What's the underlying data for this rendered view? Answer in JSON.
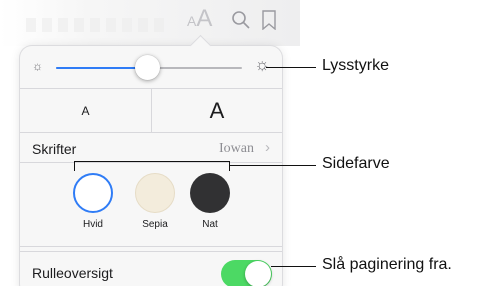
{
  "toolbar": {
    "icons": [
      "font-size-icon",
      "search-icon",
      "bookmark-icon"
    ],
    "aa_glyph_small": "A",
    "aa_glyph_large": "A",
    "search_glyph": "⚲",
    "bookmark_glyph": "⛉"
  },
  "brightness": {
    "level": 0.49,
    "low_icon": "sun-small-icon",
    "high_icon": "sun-large-icon",
    "accent_color": "#2f7cf6"
  },
  "font_size": {
    "smaller_label": "A",
    "larger_label": "A"
  },
  "font": {
    "label": "Skrifter",
    "value": "Iowan",
    "chevron": "›"
  },
  "page_colors": {
    "selected": "Hvid",
    "options": [
      {
        "label": "Hvid",
        "color": "#ffffff"
      },
      {
        "label": "Sepia",
        "color": "#f3ecdc"
      },
      {
        "label": "Nat",
        "color": "#313133"
      }
    ]
  },
  "scroll_view": {
    "label": "Rulleoversigt",
    "enabled": true,
    "on_color": "#4cd964"
  },
  "callouts": {
    "brightness": "Lysstyrke",
    "page_color": "Sidefarve",
    "pagination": "Slå paginering fra."
  }
}
